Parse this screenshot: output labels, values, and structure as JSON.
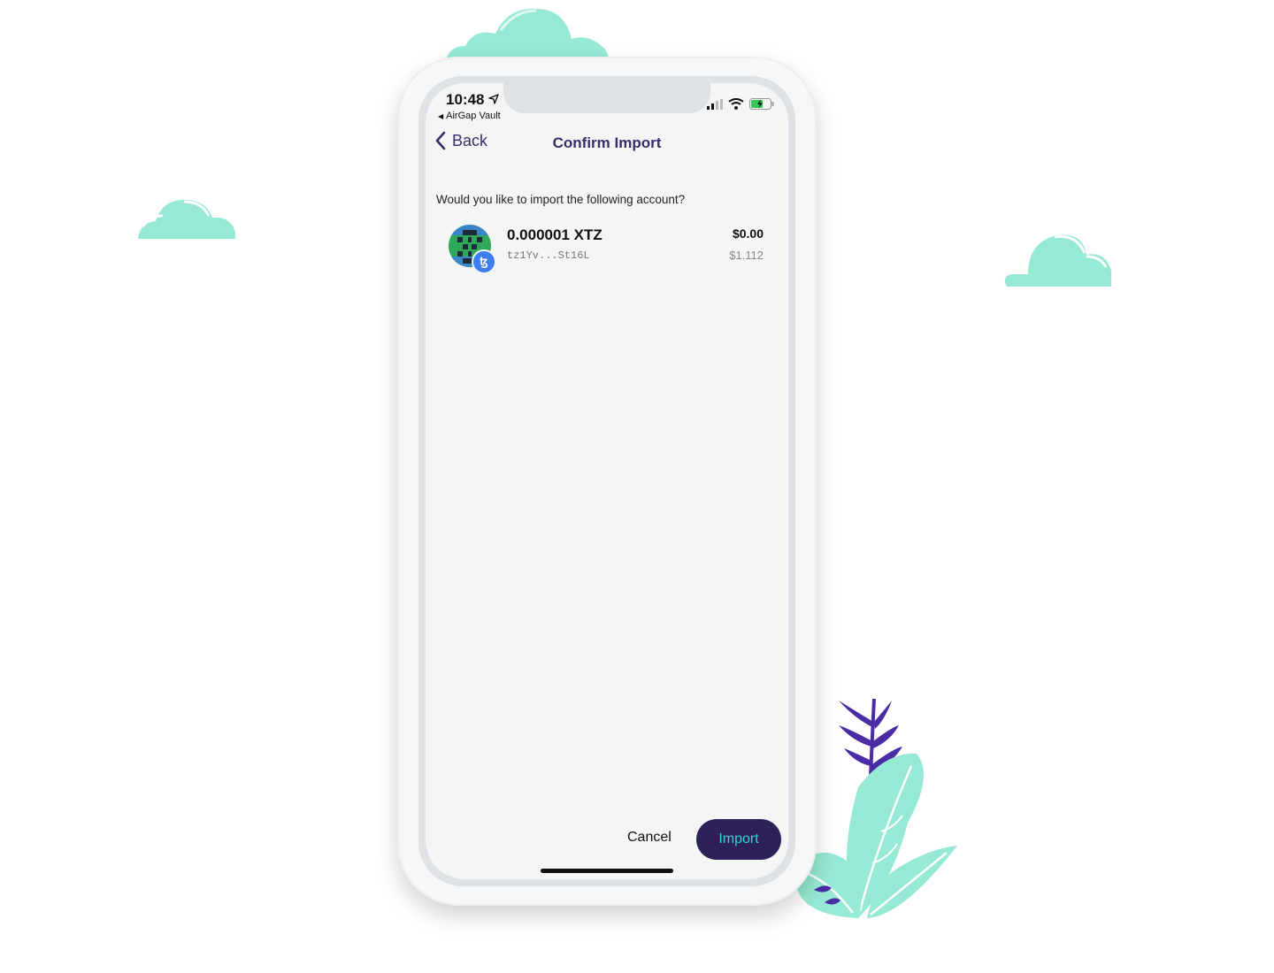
{
  "status_bar": {
    "time": "10:48",
    "back_app": "AirGap Vault",
    "location_icon": "location-arrow-icon",
    "signal_icon": "cellular-signal-icon",
    "wifi_icon": "wifi-icon",
    "battery_icon": "battery-charging-icon"
  },
  "nav": {
    "back_label": "Back",
    "title": "Confirm Import"
  },
  "content": {
    "question": "Would you like to import the following account?",
    "account": {
      "amount": "0.000001 XTZ",
      "address": "tz1Yv...St16L",
      "fiat_value": "$0.00",
      "price": "$1.112",
      "badge_symbol": "ꜩ"
    }
  },
  "actions": {
    "cancel_label": "Cancel",
    "import_label": "Import"
  },
  "colors": {
    "primary": "#2d2158",
    "accent": "#2fd4d4",
    "nav_text": "#3b2c6b",
    "cloud": "#96ead5",
    "leaf_purple": "#4a2ca5",
    "tezos_blue": "#3d7ef2"
  }
}
